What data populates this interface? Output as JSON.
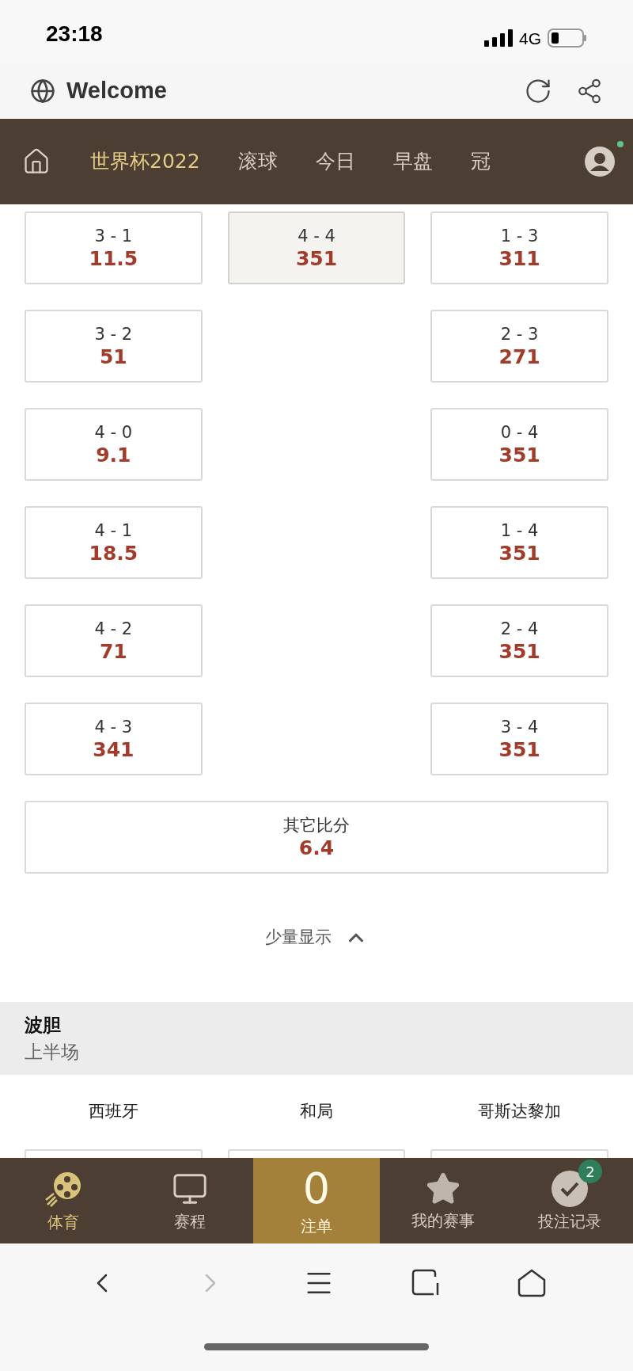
{
  "status_bar": {
    "time": "23:18",
    "network": "4G"
  },
  "browser": {
    "title": "Welcome"
  },
  "nav": {
    "tabs": [
      {
        "label": "世界杯2022",
        "selected": true
      },
      {
        "label": "滚球",
        "selected": false
      },
      {
        "label": "今日",
        "selected": false
      },
      {
        "label": "早盘",
        "selected": false
      },
      {
        "label": "冠",
        "selected": false
      }
    ],
    "profile_dot": true
  },
  "correct_score": {
    "rows": [
      {
        "home": {
          "score": "3 - 1",
          "odds": "11.5",
          "selected": false
        },
        "draw": {
          "score": "4 - 4",
          "odds": "351",
          "selected": true
        },
        "away": {
          "score": "1 - 3",
          "odds": "311",
          "selected": false
        }
      },
      {
        "home": {
          "score": "3 - 2",
          "odds": "51",
          "selected": false
        },
        "away": {
          "score": "2 - 3",
          "odds": "271",
          "selected": false
        }
      },
      {
        "home": {
          "score": "4 - 0",
          "odds": "9.1",
          "selected": false
        },
        "away": {
          "score": "0 - 4",
          "odds": "351",
          "selected": false
        }
      },
      {
        "home": {
          "score": "4 - 1",
          "odds": "18.5",
          "selected": false
        },
        "away": {
          "score": "1 - 4",
          "odds": "351",
          "selected": false
        }
      },
      {
        "home": {
          "score": "4 - 2",
          "odds": "71",
          "selected": false
        },
        "away": {
          "score": "2 - 4",
          "odds": "351",
          "selected": false
        }
      },
      {
        "home": {
          "score": "4 - 3",
          "odds": "341",
          "selected": false
        },
        "away": {
          "score": "3 - 4",
          "odds": "351",
          "selected": false
        }
      }
    ],
    "other": {
      "score": "其它比分",
      "odds": "6.4",
      "selected": false
    },
    "toggle": "少量显示"
  },
  "section": {
    "title": "波胆",
    "subtitle": "上半场",
    "columns": [
      "西班牙",
      "和局",
      "哥斯达黎加"
    ]
  },
  "bottom_nav": [
    {
      "kind": "sports",
      "label": "体育",
      "selected": true
    },
    {
      "kind": "schedule",
      "label": "赛程",
      "selected": false
    },
    {
      "kind": "betslip",
      "count": "0",
      "label": "注单",
      "selected": false
    },
    {
      "kind": "favorites",
      "label": "我的赛事",
      "selected": false
    },
    {
      "kind": "records",
      "label": "投注记录",
      "badge": "2",
      "selected": false
    }
  ]
}
